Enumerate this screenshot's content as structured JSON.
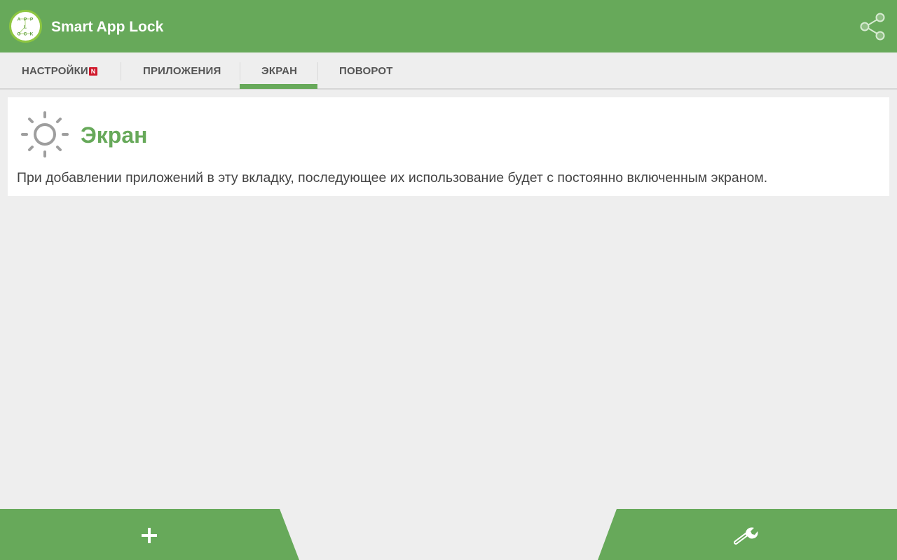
{
  "app": {
    "title": "Smart App Lock",
    "logo_letters": [
      "A",
      "P",
      "P",
      "L",
      "O",
      "C",
      "K"
    ],
    "brand_color": "#67a95a",
    "logo_ring_color": "#8dc641"
  },
  "header": {
    "share_icon": "share-icon"
  },
  "tabs": [
    {
      "label": "НАСТРОЙКИ",
      "badge": "N",
      "selected": false
    },
    {
      "label": "ПРИЛОЖЕНИЯ",
      "selected": false
    },
    {
      "label": "ЭКРАН",
      "selected": true
    },
    {
      "label": "ПОВОРОТ",
      "selected": false
    }
  ],
  "card": {
    "icon": "brightness-sun-icon",
    "title": "Экран",
    "description": "При добавлении приложений в эту вкладку, последующее их использование будет с постоянно включенным экраном."
  },
  "bottom": {
    "add_icon": "plus-icon",
    "tools_icon": "wrench-icon"
  }
}
